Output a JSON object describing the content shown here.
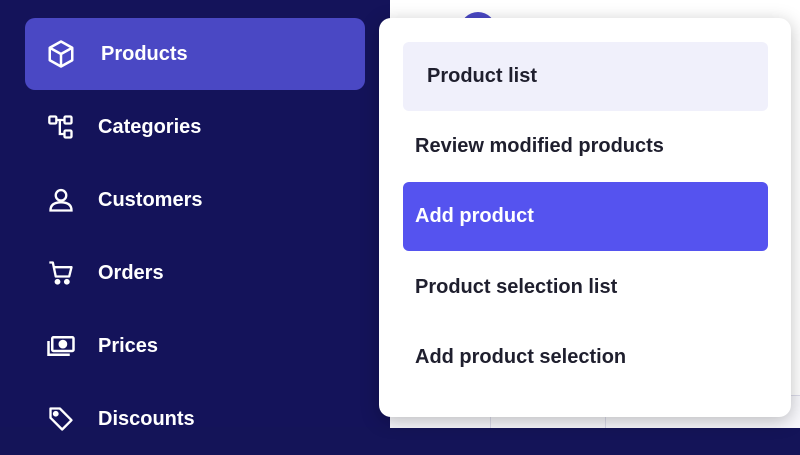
{
  "sidebar": {
    "items": [
      {
        "label": "Products",
        "icon": "box-icon",
        "active": true
      },
      {
        "label": "Categories",
        "icon": "hierarchy-icon"
      },
      {
        "label": "Customers",
        "icon": "user-icon"
      },
      {
        "label": "Orders",
        "icon": "cart-icon"
      },
      {
        "label": "Prices",
        "icon": "cash-icon"
      },
      {
        "label": "Discounts",
        "icon": "tag-icon"
      }
    ]
  },
  "dropdown": {
    "items": [
      {
        "label": "Product list",
        "state": "selected"
      },
      {
        "label": "Review modified products"
      },
      {
        "label": "Add product",
        "state": "hover"
      },
      {
        "label": "Product selection list"
      },
      {
        "label": "Add product selection"
      }
    ]
  },
  "colors": {
    "sidebar_bg": "#14135a",
    "active_item": "#4a48c4",
    "menu_hover": "#5553ef",
    "menu_selected": "#f0f0fb"
  }
}
